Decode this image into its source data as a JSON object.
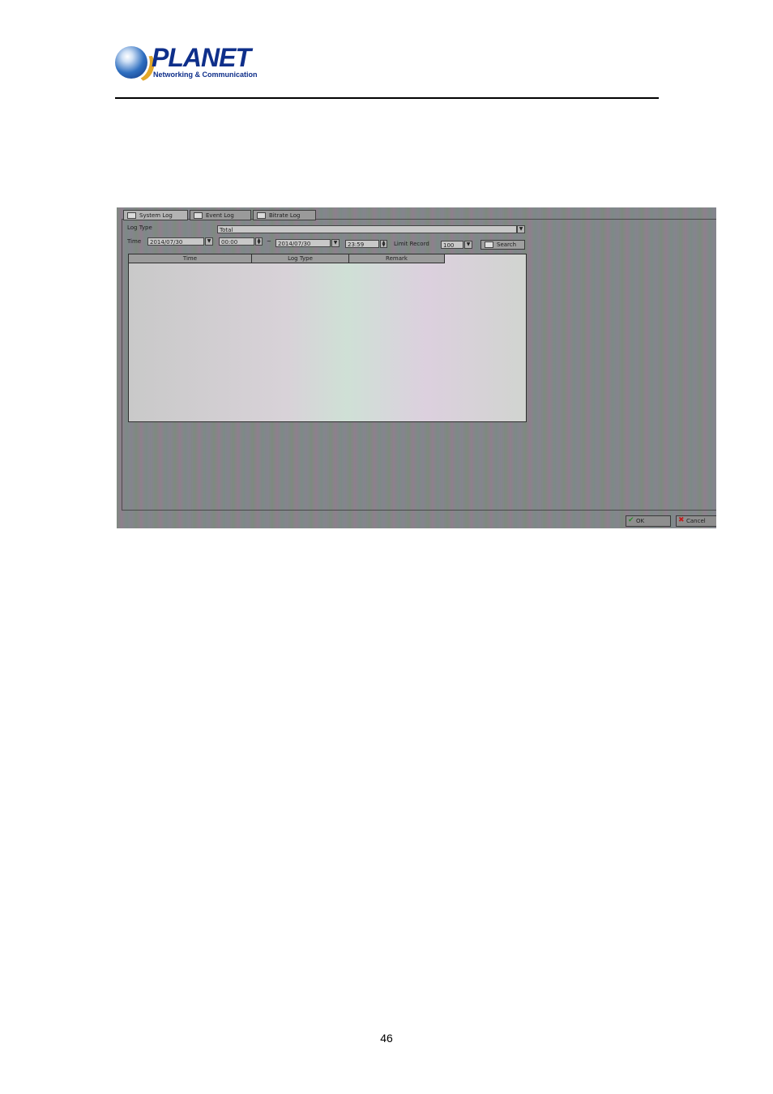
{
  "header": {
    "brand": "PLANET",
    "tagline": "Networking & Communication"
  },
  "screen": {
    "tabs": [
      {
        "label": "System Log"
      },
      {
        "label": "Event Log"
      },
      {
        "label": "Bitrate Log"
      }
    ],
    "log_type_label": "Log Type",
    "log_type_value": "Total",
    "time_label": "Time",
    "start_date": "2014/07/30",
    "start_time": "00:00",
    "separator": "~",
    "end_date": "2014/07/30",
    "end_time": "23:59",
    "limit_label": "Limit Record",
    "limit_value": "100",
    "search_label": "Search",
    "columns": [
      "Time",
      "Log Type",
      "Remark"
    ],
    "ok_label": "OK",
    "cancel_label": "Cancel"
  },
  "footer": {
    "page_number": "46"
  }
}
